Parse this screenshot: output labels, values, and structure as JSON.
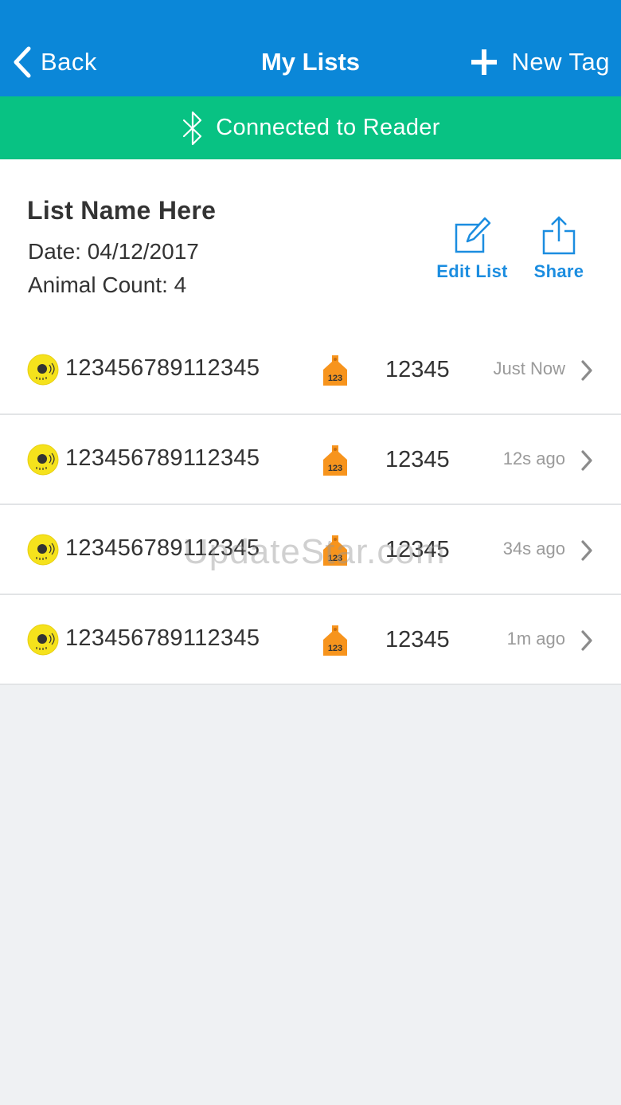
{
  "navbar": {
    "back_label": "Back",
    "title": "My Lists",
    "new_tag_label": "New Tag"
  },
  "status": {
    "text": "Connected to Reader",
    "icon": "bluetooth-icon"
  },
  "list": {
    "name": "List Name Here",
    "date_line": "Date: 04/12/2017",
    "count_line": "Animal Count: 4",
    "edit_label": "Edit List",
    "share_label": "Share"
  },
  "rows": [
    {
      "eid": "123456789112345",
      "tag_text": "123",
      "visual_id": "12345",
      "time": "Just Now"
    },
    {
      "eid": "123456789112345",
      "tag_text": "123",
      "visual_id": "12345",
      "time": "12s ago"
    },
    {
      "eid": "123456789112345",
      "tag_text": "123",
      "visual_id": "12345",
      "time": "34s ago"
    },
    {
      "eid": "123456789112345",
      "tag_text": "123",
      "visual_id": "12345",
      "time": "1m ago"
    }
  ],
  "watermark": "UpdateStar.com",
  "colors": {
    "navbar": "#0b87d8",
    "status": "#08c283",
    "accent": "#1b8de0",
    "eid_icon": "#f5e21c",
    "tag_icon": "#f7941d"
  }
}
